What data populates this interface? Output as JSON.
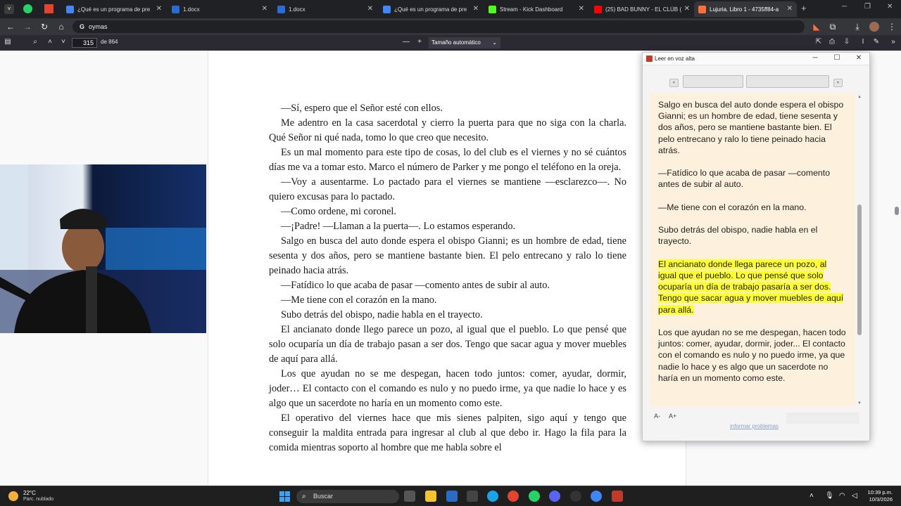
{
  "browser": {
    "tabs": [
      {
        "label": "¿Qué es un programa de pre",
        "color": "#4285f4"
      },
      {
        "label": "1.docx",
        "color": "#2b6bd6"
      },
      {
        "label": "1.docx",
        "color": "#2b6bd6"
      },
      {
        "label": "¿Qué es un programa de pre",
        "color": "#4285f4"
      },
      {
        "label": "Stream - Kick Dashboard",
        "color": "#53fc18"
      },
      {
        "label": "(25) BAD BUNNY - EL CLÚB (",
        "color": "#ff0000"
      },
      {
        "label": "Lujuria. Libro 1 - 4735ff84-a",
        "color": "#ff7139"
      }
    ],
    "new_tab": "+",
    "address": "oymas"
  },
  "pdf_toolbar": {
    "page_number": "315",
    "page_of": "de 864",
    "zoom_minus": "—",
    "zoom_plus": "+",
    "zoom": "Tamaño automático"
  },
  "page": {
    "paragraphs": [
      "—Sí, espero que el Señor esté con ellos.",
      "Me adentro en la casa sacerdotal y cierro la puerta para que no siga con la charla. Qué Señor ni qué nada, tomo lo que creo que necesito.",
      "Es un mal momento para este tipo de cosas, lo del club es el viernes y no sé cuántos días me va a tomar esto. Marco el número de Parker y me pongo el teléfono en la oreja.",
      "—Voy a ausentarme. Lo pactado para el viernes se mantiene —esclarezco—. No quiero excusas para lo pactado.",
      "—Como ordene, mi coronel.",
      "—¡Padre! —Llaman a la puerta—. Lo estamos esperando.",
      "Salgo en busca del auto donde espera el obispo Gianni; es un hombre de edad, tiene sesenta y dos años, pero se mantiene bastante bien. El pelo entrecano y ralo lo tiene peinado hacia atrás.",
      "—Fatídico lo que acaba de pasar —comento antes de subir al auto.",
      "—Me tiene con el corazón en la mano.",
      "Subo detrás del obispo, nadie habla en el trayecto.",
      "El ancianato donde llego parece un pozo, al igual que el pueblo. Lo que pensé que solo ocuparía un día de trabajo pasan a ser dos. Tengo que sacar agua y mover muebles de aquí para allá.",
      "Los que ayudan no se me despegan, hacen todo juntos: comer, ayudar, dormir, joder… El contacto con el comando es nulo y no puedo irme, ya que nadie lo hace y es algo que un sacerdote no haría en un momento como este.",
      "El operativo del viernes hace que mis sienes palpiten, sigo aquí y tengo que conseguir la maldita entrada para ingresar al club al que debo ir. Hago la fila para la comida mientras soporto al hombre que me habla sobre el"
    ]
  },
  "read_aloud": {
    "title": "Leer en voz alta",
    "btn_prev": "«",
    "btn_next": "»",
    "paragraphs": [
      "Salgo en busca del auto donde espera el obispo Gianni; es un hombre de edad, tiene sesenta y dos años, pero se mantiene bastante bien. El pelo entrecano y ralo lo tiene peinado hacia atrás.",
      "—Fatídico lo que acaba de pasar —comento antes de subir al auto.",
      "—Me tiene con el corazón en la mano.",
      "Subo detrás del obispo, nadie habla en el trayecto.",
      "El ancianato donde llega parece un pozo, al igual que el pueblo. Lo que pensé que solo ocuparía un día de trabajo pasaría a ser dos. Tengo que sacar agua y mover muebles de aquí para allá.",
      "Los que ayudan no se me despegan, hacen todo juntos: comer, ayudar, dormir, joder... El contacto con el comando es nulo y no puedo irme, ya que nadie lo hace y es algo que un sacerdote no haría en un momento como este."
    ],
    "highlighted_index": 4,
    "font_smaller": "A-",
    "font_larger": "A+",
    "report_link": "informar problemas",
    "highlight_color": "#ffff33"
  },
  "taskbar": {
    "temperature": "22°C",
    "condition": "Parc. nublado",
    "search_placeholder": "Buscar",
    "time": "10:39 p.m.",
    "date": "10/3/2026"
  }
}
